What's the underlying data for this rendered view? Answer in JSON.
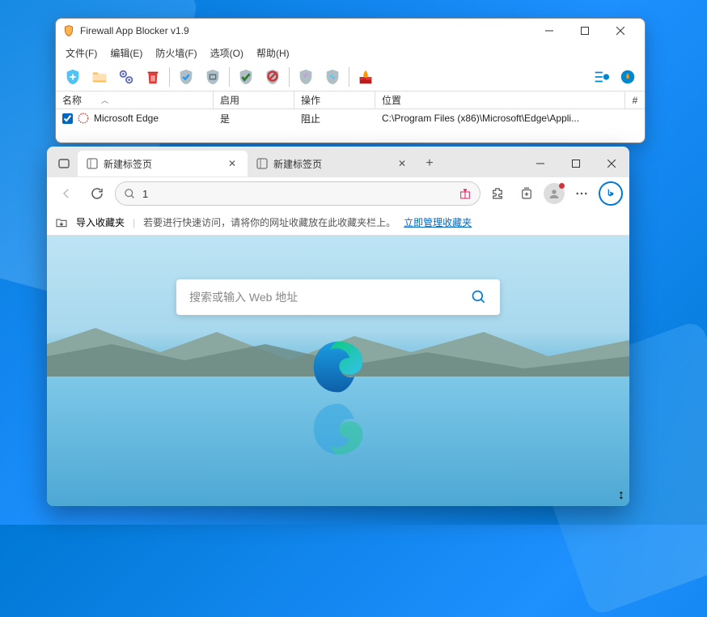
{
  "firewall": {
    "title": "Firewall App Blocker v1.9",
    "menu": {
      "file": "文件(F)",
      "edit": "编辑(E)",
      "firewall": "防火墙(F)",
      "options": "选项(O)",
      "help": "帮助(H)"
    },
    "columns": {
      "name": "名称",
      "enable": "启用",
      "action": "操作",
      "location": "位置",
      "hash": "#"
    },
    "rows": [
      {
        "checked": true,
        "name": "Microsoft Edge",
        "enable": "是",
        "action": "阻止",
        "location": "C:\\Program Files (x86)\\Microsoft\\Edge\\Appli..."
      }
    ]
  },
  "edge": {
    "tabs": [
      {
        "title": "新建标签页",
        "active": true
      },
      {
        "title": "新建标签页",
        "active": false
      }
    ],
    "address_value": "1",
    "favbar": {
      "import": "导入收藏夹",
      "hint": "若要进行快速访问，请将你的网址收藏放在此收藏夹栏上。",
      "link": "立即管理收藏夹"
    },
    "search_placeholder": "搜索或输入 Web 地址"
  }
}
